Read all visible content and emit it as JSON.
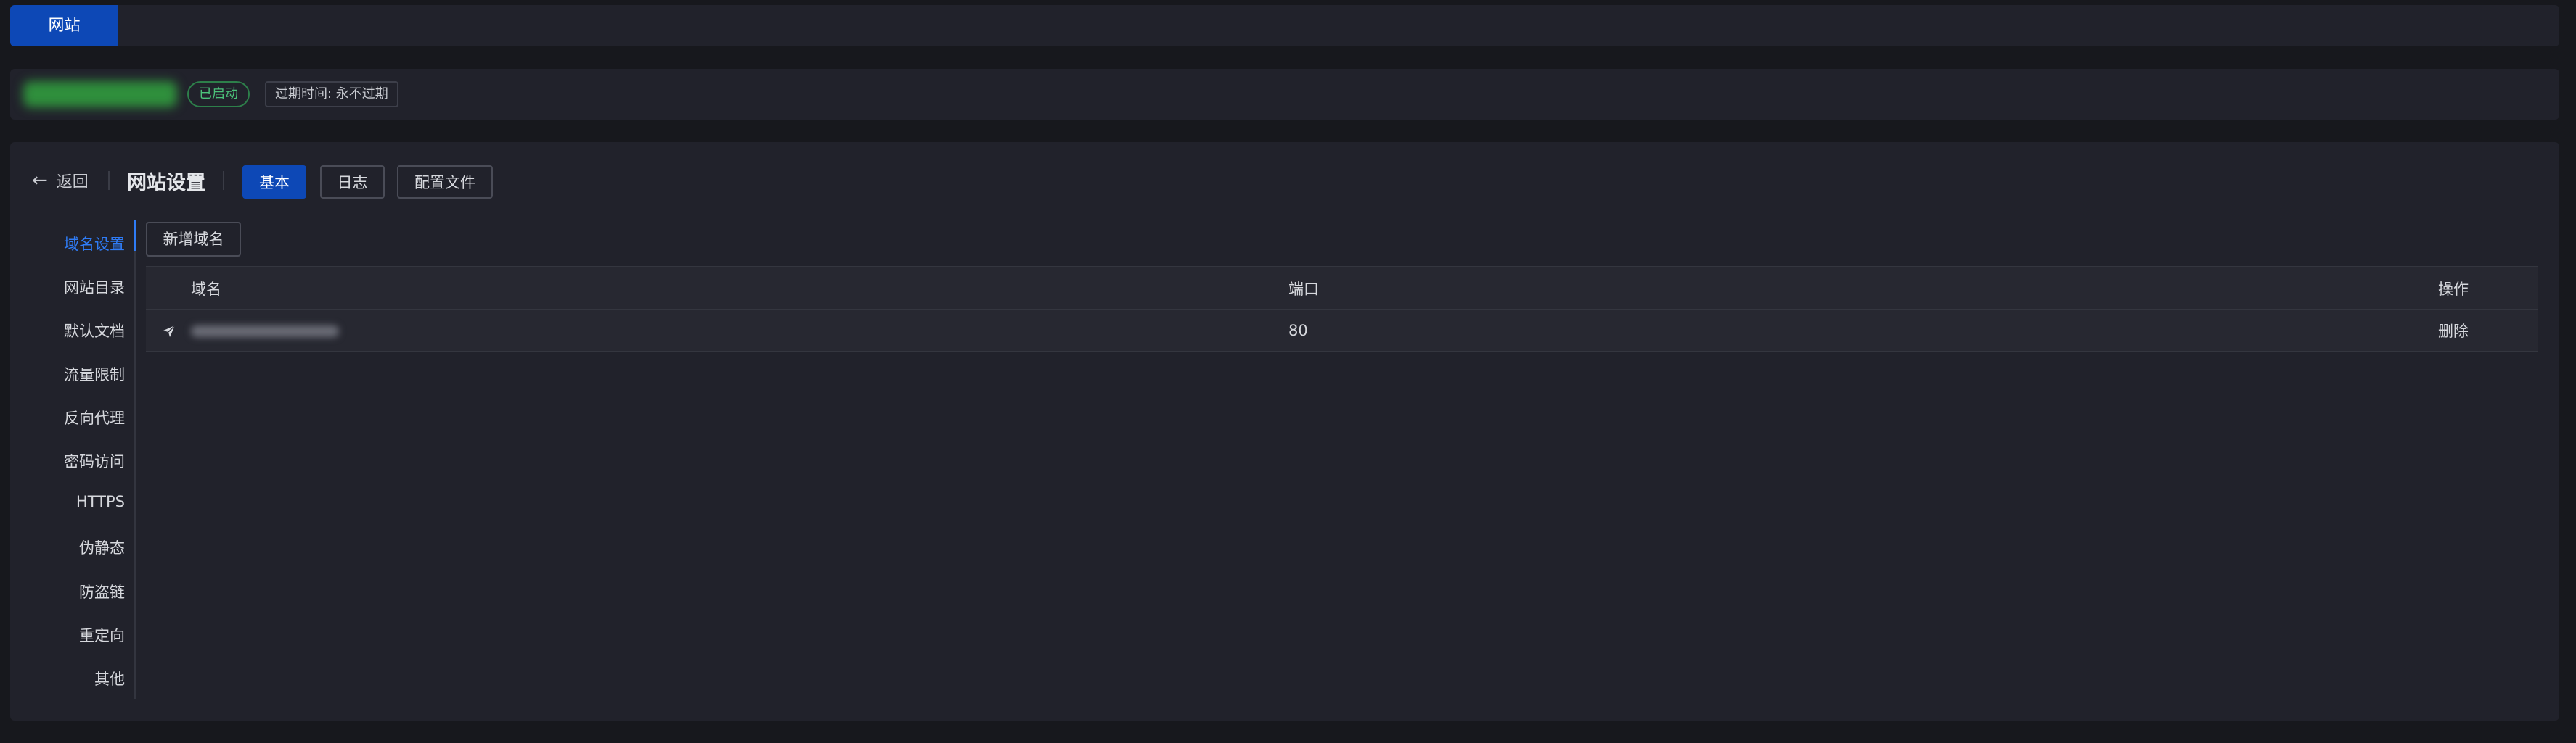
{
  "tabs": [
    {
      "label": "网站",
      "active": true
    }
  ],
  "site_info": {
    "status": "已启动",
    "expire": "过期时间: 永不过期"
  },
  "header": {
    "back_label": "返回",
    "title": "网站设置",
    "modes": [
      {
        "label": "基本",
        "active": true
      },
      {
        "label": "日志",
        "active": false
      },
      {
        "label": "配置文件",
        "active": false
      }
    ]
  },
  "side_nav": {
    "items": [
      {
        "label": "域名设置",
        "active": true
      },
      {
        "label": "网站目录",
        "active": false
      },
      {
        "label": "默认文档",
        "active": false
      },
      {
        "label": "流量限制",
        "active": false
      },
      {
        "label": "反向代理",
        "active": false
      },
      {
        "label": "密码访问",
        "active": false
      },
      {
        "label": "HTTPS",
        "active": false
      },
      {
        "label": "伪静态",
        "active": false
      },
      {
        "label": "防盗链",
        "active": false
      },
      {
        "label": "重定向",
        "active": false
      },
      {
        "label": "其他",
        "active": false
      }
    ]
  },
  "domain_panel": {
    "add_button": "新增域名",
    "columns": {
      "domain": "域名",
      "port": "端口",
      "action": "操作"
    },
    "rows": [
      {
        "port": "80",
        "action": "删除",
        "icon": "send-icon"
      }
    ]
  },
  "colors": {
    "accent": "#0d48b6",
    "active_text": "#2f7cf6",
    "status_green": "#4cc27a",
    "background": "#17181d",
    "panel": "#21222b"
  }
}
